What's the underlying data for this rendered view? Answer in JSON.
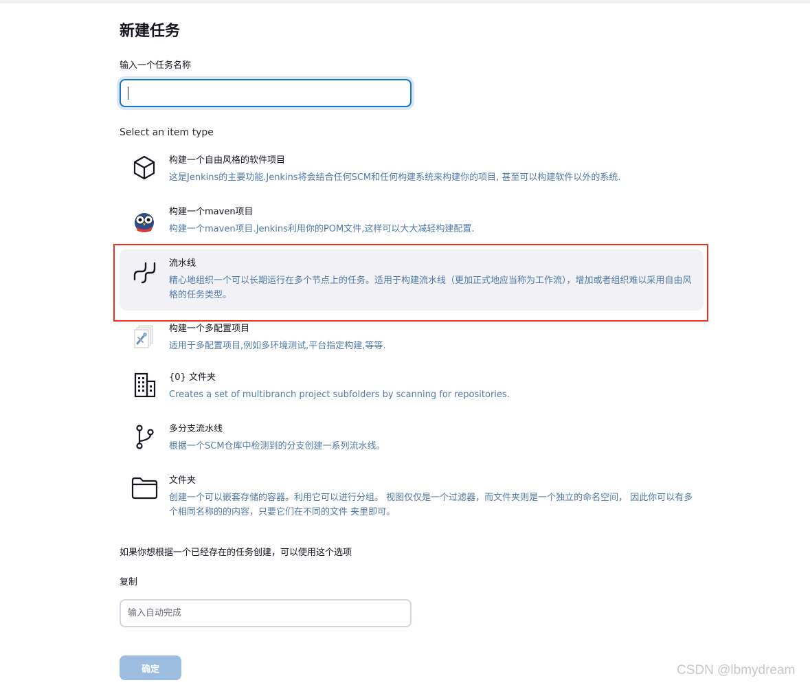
{
  "page": {
    "title": "新建任务"
  },
  "name_field": {
    "label": "输入一个任务名称",
    "value": ""
  },
  "item_type": {
    "label": "Select an item type",
    "items": [
      {
        "title": "构建一个自由风格的软件项目",
        "desc": "这是Jenkins的主要功能.Jenkins将会结合任何SCM和任何构建系统来构建你的项目, 甚至可以构建软件以外的系统.",
        "icon": "package-icon",
        "selected": false
      },
      {
        "title": "构建一个maven项目",
        "desc": "构建一个maven项目.Jenkins利用你的POM文件,这样可以大大减轻构建配置.",
        "icon": "maven-owl-icon",
        "selected": false
      },
      {
        "title": "流水线",
        "desc": "精心地组织一个可以长期运行在多个节点上的任务。适用于构建流水线（更加正式地应当称为工作流），增加或者组织难以采用自由风格的任务类型。",
        "icon": "pipeline-icon",
        "selected": true
      },
      {
        "title": "构建一个多配置项目",
        "desc": "适用于多配置项目,例如多环境测试,平台指定构建,等等.",
        "icon": "multi-config-icon",
        "selected": false
      },
      {
        "title": "{0} 文件夹",
        "desc": "Creates a set of multibranch project subfolders by scanning for repositories.",
        "icon": "organization-building-icon",
        "selected": false
      },
      {
        "title": "多分支流水线",
        "desc": "根据一个SCM仓库中检测到的分支创建一系列流水线。",
        "icon": "branch-icon",
        "selected": false
      },
      {
        "title": "文件夹",
        "desc": "创建一个可以嵌套存储的容器。利用它可以进行分组。 视图仅仅是一个过滤器，而文件夹则是一个独立的命名空间， 因此你可以有多个相同名称的的内容，只要它们在不同的文件 夹里即可。",
        "icon": "folder-icon",
        "selected": false
      }
    ]
  },
  "copy_section": {
    "hint": "如果你想根据一个已经存在的任务创建，可以使用这个选项",
    "label": "复制",
    "placeholder": "输入自动完成"
  },
  "ok_button": {
    "label": "确定"
  },
  "colors": {
    "accent": "#1a73c4",
    "highlight_border": "#e8301c",
    "desc_text": "#4f79a6",
    "button_bg": "#9dbde0",
    "selected_bg": "#f2f2f6"
  },
  "watermark": "CSDN @lbmydream"
}
